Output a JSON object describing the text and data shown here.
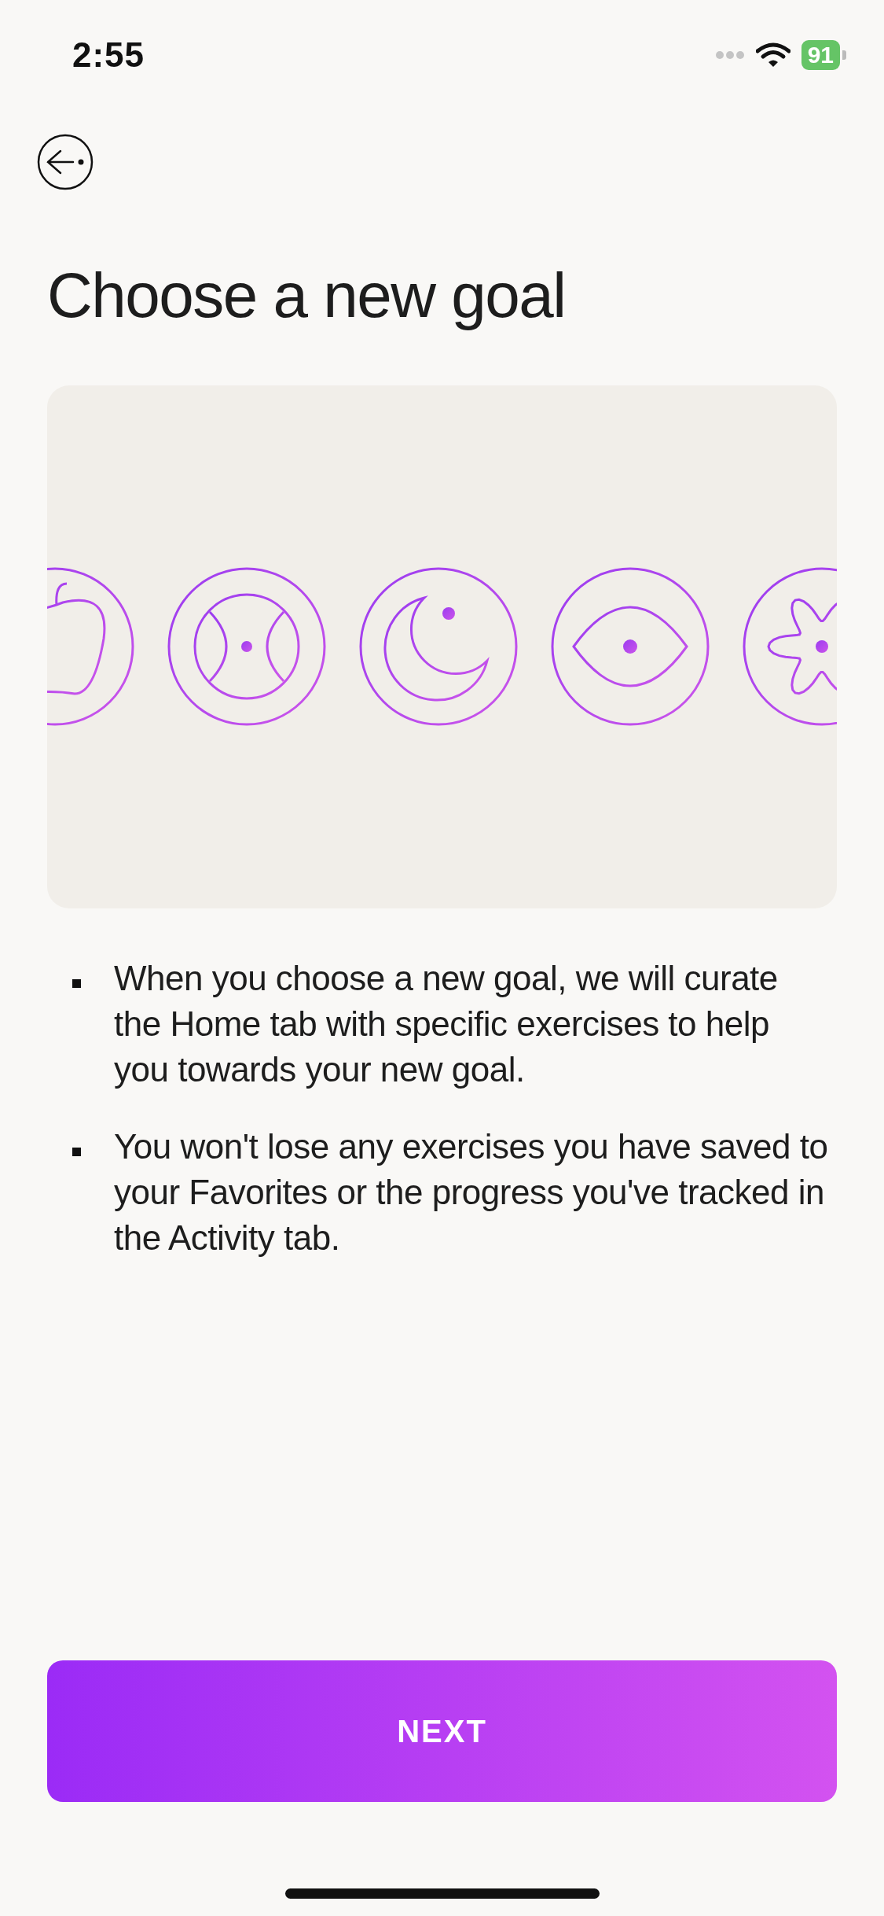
{
  "status_bar": {
    "time": "2:55",
    "battery": "91"
  },
  "title": "Choose a new goal",
  "illustration": {
    "icons": [
      {
        "kind": "apple"
      },
      {
        "kind": "ball"
      },
      {
        "kind": "moon"
      },
      {
        "kind": "eye"
      },
      {
        "kind": "flower"
      }
    ]
  },
  "bullets": [
    "When you choose a new goal, we will curate the Home tab with specific exercises to help you towards your new goal.",
    "You won't lose any exercises you have saved to your Favorites or the progress you've tracked in the Activity tab."
  ],
  "button": {
    "label": "NEXT"
  }
}
